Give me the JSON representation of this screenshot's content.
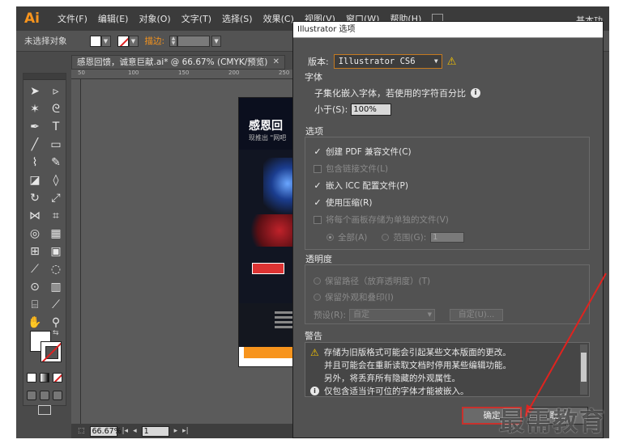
{
  "app": {
    "logo": "Ai",
    "menu": [
      "文件(F)",
      "编辑(E)",
      "对象(O)",
      "文字(T)",
      "选择(S)",
      "效果(C)",
      "视图(V)",
      "窗口(W)",
      "帮助(H)"
    ],
    "workspace": "基本功"
  },
  "controlbar": {
    "selection_state": "未选择对象",
    "stroke_label": "描边:"
  },
  "document": {
    "tab_title": "感恩回馈，诚意巨献.ai* @ 66.67% (CMYK/预览)",
    "ruler_ticks": [
      "50",
      "100",
      "150",
      "200",
      "250"
    ],
    "zoom": "66.67%",
    "page": "1",
    "artwork": {
      "title": "感恩回",
      "subtitle": "现推出 \"网吧"
    }
  },
  "dialog": {
    "title": "Illustrator 选项",
    "version_label": "版本:",
    "version_value": "Illustrator CS6",
    "font_group": {
      "label": "字体",
      "line1": "子集化嵌入字体，若使用的字符百分比",
      "line2_label": "小于(S):",
      "percent": "100%"
    },
    "options_group": {
      "label": "选项",
      "items": [
        {
          "label": "创建 PDF 兼容文件(C)",
          "checked": true,
          "enabled": true
        },
        {
          "label": "包含链接文件(L)",
          "checked": false,
          "enabled": false
        },
        {
          "label": "嵌入 ICC 配置文件(P)",
          "checked": true,
          "enabled": true
        },
        {
          "label": "使用压缩(R)",
          "checked": true,
          "enabled": true
        },
        {
          "label": "将每个画板存储为单独的文件(V)",
          "checked": false,
          "enabled": false
        }
      ],
      "radio_all": "全部(A)",
      "radio_range": "范围(G):",
      "range_value": "1"
    },
    "transparency_group": {
      "label": "透明度",
      "opt1": "保留路径（放弃透明度）(T)",
      "opt2": "保留外观和叠印(I)",
      "preset_label": "预设(R):",
      "preset_value": "自定",
      "custom_button": "自定(U)..."
    },
    "warnings": {
      "label": "警告",
      "line1": "存储为旧版格式可能会引起某些文本版面的更改。",
      "line2": "并且可能会在重新读取文档时停用某些编辑功能。",
      "line3": "另外，将丢弃所有隐藏的外观属性。",
      "line4": "仅包含适当许可位的字体才能被嵌入。"
    },
    "ok_button": "确定",
    "cancel_button": "取消"
  },
  "watermark": "最需教育",
  "colors": {
    "accent": "#f7941d",
    "highlight": "#c8312c",
    "warning": "#f5c400"
  }
}
